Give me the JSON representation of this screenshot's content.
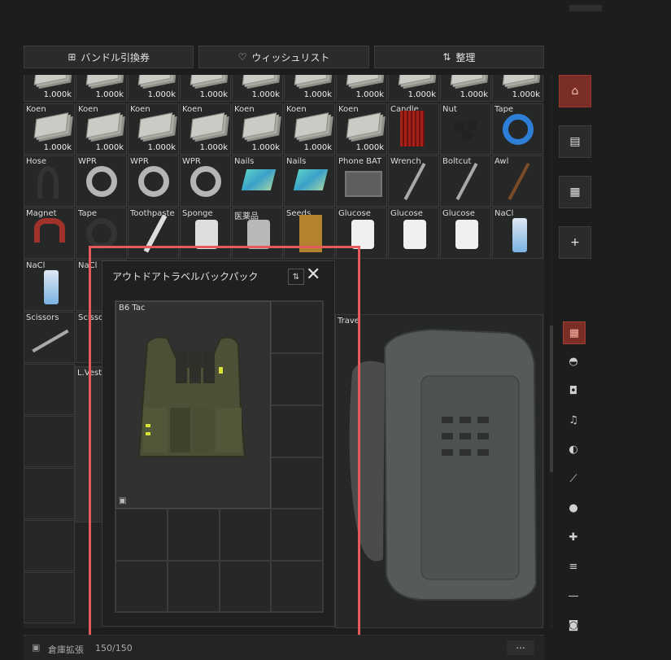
{
  "toolbar": {
    "bundle_label": "バンドル引換券",
    "wishlist_label": "ウィッシュリスト",
    "sort_label": "整理"
  },
  "stash_items": {
    "row0": [
      "1.000k",
      "1.000k",
      "1.000k",
      "1.000k",
      "1.000k",
      "1.000k",
      "1.000k",
      "1.000k",
      "1.000k",
      "1.000k"
    ],
    "row1": [
      {
        "name": "Koen",
        "count": "1.000k"
      },
      {
        "name": "Koen",
        "count": "1.000k"
      },
      {
        "name": "Koen",
        "count": "1.000k"
      },
      {
        "name": "Koen",
        "count": "1.000k"
      },
      {
        "name": "Koen",
        "count": "1.000k"
      },
      {
        "name": "Koen",
        "count": "1.000k"
      },
      {
        "name": "Koen",
        "count": "1.000k"
      },
      {
        "name": "Candle",
        "count": ""
      },
      {
        "name": "Nut",
        "count": ""
      },
      {
        "name": "Tape",
        "count": ""
      }
    ],
    "row2": [
      "Hose",
      "WPR",
      "WPR",
      "WPR",
      "Nails",
      "Nails",
      "Phone BAT",
      "Wrench",
      "Boltcut",
      "Awl"
    ],
    "row3": [
      "Magnet",
      "Tape",
      "Toothpaste",
      "Sponge",
      "医薬品",
      "Seeds",
      "Glucose",
      "Glucose",
      "Glucose",
      "NaCl"
    ],
    "row4": [
      "NaCl",
      "NaCl"
    ],
    "row5": [
      "Scissors",
      "Scissors"
    ],
    "lvest": "L.Vest",
    "travel": "Trave"
  },
  "popup": {
    "title": "アウトドアトラベルバックパック",
    "inner_item": "B6 Tac"
  },
  "footer": {
    "label": "倉庫拡張",
    "capacity": "150/150",
    "more": "..."
  },
  "colors": {
    "accent": "#7a2e26",
    "highlight": "#e35b5b"
  }
}
